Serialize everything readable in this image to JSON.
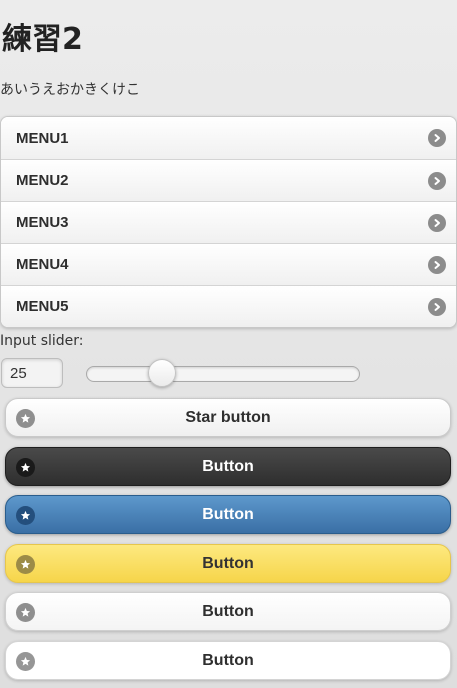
{
  "page": {
    "title": "練習2",
    "subtitle": "あいうえおかきくけこ"
  },
  "menu": {
    "items": [
      {
        "label": "MENU1",
        "icon": "chevron-right-icon"
      },
      {
        "label": "MENU2",
        "icon": "chevron-right-icon"
      },
      {
        "label": "MENU3",
        "icon": "chevron-right-icon"
      },
      {
        "label": "MENU4",
        "icon": "chevron-right-icon"
      },
      {
        "label": "MENU5",
        "icon": "chevron-right-icon"
      }
    ]
  },
  "slider": {
    "label": "Input slider:",
    "value": "25",
    "min": 0,
    "max": 100
  },
  "buttons": [
    {
      "label": "Star button",
      "icon": "star-icon",
      "theme": "c",
      "color": "#f6f6f6"
    },
    {
      "label": "Button",
      "icon": "star-icon",
      "theme": "a",
      "color": "#333333"
    },
    {
      "label": "Button",
      "icon": "star-icon",
      "theme": "b",
      "color": "#4a80b8"
    },
    {
      "label": "Button",
      "icon": "star-icon",
      "theme": "e",
      "color": "#fadb4e"
    },
    {
      "label": "Button",
      "icon": "star-icon",
      "theme": "d",
      "color": "#f9f9f9"
    },
    {
      "label": "Button",
      "icon": "star-icon",
      "theme": "w",
      "color": "#ffffff"
    }
  ]
}
